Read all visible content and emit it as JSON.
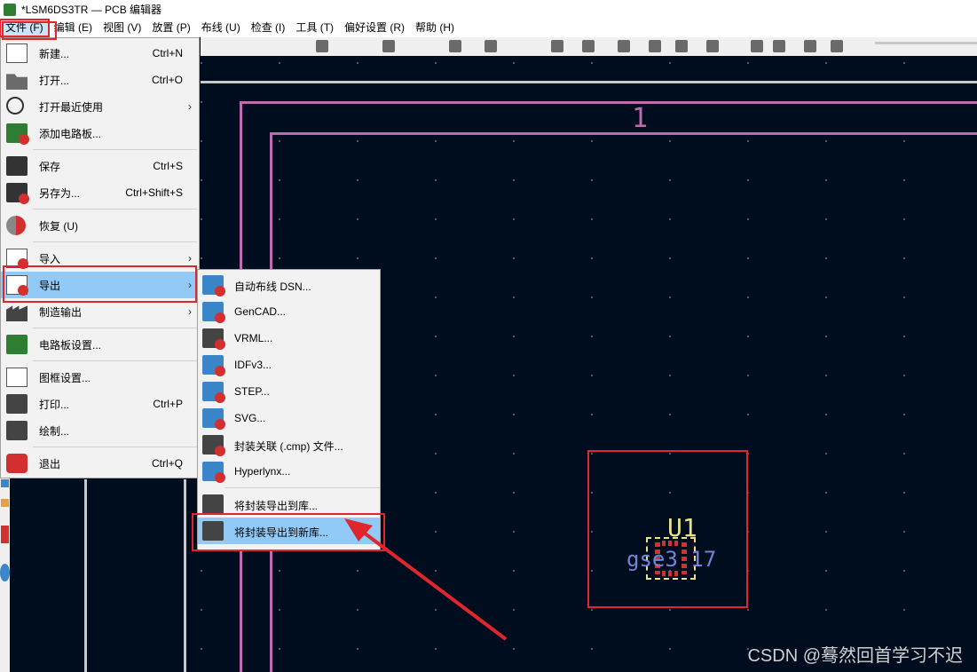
{
  "window": {
    "title": "*LSM6DS3TR — PCB 编辑器"
  },
  "menubar": [
    {
      "label": "文件 (F)",
      "active": true
    },
    {
      "label": "编辑 (E)"
    },
    {
      "label": "视图 (V)"
    },
    {
      "label": "放置 (P)"
    },
    {
      "label": "布线 (U)"
    },
    {
      "label": "检查 (I)"
    },
    {
      "label": "工具 (T)"
    },
    {
      "label": "偏好设置 (R)"
    },
    {
      "label": "帮助 (H)"
    }
  ],
  "file_menu": [
    {
      "label": "新建...",
      "shortcut": "Ctrl+N",
      "icon": "new-page-icon"
    },
    {
      "label": "打开...",
      "shortcut": "Ctrl+O",
      "icon": "folder-icon"
    },
    {
      "label": "打开最近使用",
      "submenu": true,
      "icon": "clock-icon"
    },
    {
      "label": "添加电路板...",
      "icon": "add-board-icon"
    },
    {
      "label": "保存",
      "shortcut": "Ctrl+S",
      "icon": "save-icon"
    },
    {
      "label": "另存为...",
      "shortcut": "Ctrl+Shift+S",
      "icon": "save-as-icon"
    },
    {
      "label": "恢复 (U)",
      "icon": "revert-icon"
    },
    {
      "label": "导入",
      "submenu": true,
      "icon": "import-icon"
    },
    {
      "label": "导出",
      "submenu": true,
      "highlighted": true,
      "icon": "export-icon"
    },
    {
      "label": "制造输出",
      "submenu": true,
      "icon": "fabrication-icon"
    },
    {
      "label": "电路板设置...",
      "icon": "board-setup-icon"
    },
    {
      "label": "图框设置...",
      "icon": "page-settings-icon"
    },
    {
      "label": "打印...",
      "shortcut": "Ctrl+P",
      "icon": "print-icon"
    },
    {
      "label": "绘制...",
      "icon": "plot-icon"
    },
    {
      "label": "退出",
      "shortcut": "Ctrl+Q",
      "icon": "exit-icon"
    }
  ],
  "export_submenu": [
    {
      "label": "自动布线 DSN...",
      "icon_text": ".dsn"
    },
    {
      "label": "GenCAD...",
      "icon_text": ".gcd"
    },
    {
      "label": "VRML...",
      "icon_text": ""
    },
    {
      "label": "IDFv3...",
      "icon_text": ".idf"
    },
    {
      "label": "STEP...",
      "icon_text": ".stp"
    },
    {
      "label": "SVG...",
      "icon_text": ".svg"
    },
    {
      "label": "封装关联 (.cmp) 文件...",
      "icon_text": ""
    },
    {
      "label": "Hyperlynx...",
      "icon_text": ".stp"
    },
    {
      "label": "将封装导出到库...",
      "icon_text": ""
    },
    {
      "label": "将封装导出到新库...",
      "icon_text": "",
      "highlighted": true
    }
  ],
  "canvas": {
    "sheet_label": "1",
    "footprint_ref": "U1",
    "footprint_value": "gse3 17"
  },
  "watermark": "CSDN @蓦然回首学习不迟",
  "colors": {
    "canvas_bg": "#000d1f",
    "border_pink": "#c06bb0",
    "highlight_blue": "#91c9f7",
    "annotation_red": "#e0262d",
    "ref_yellow": "#e8e48a",
    "value_blue": "#6f86d6"
  }
}
